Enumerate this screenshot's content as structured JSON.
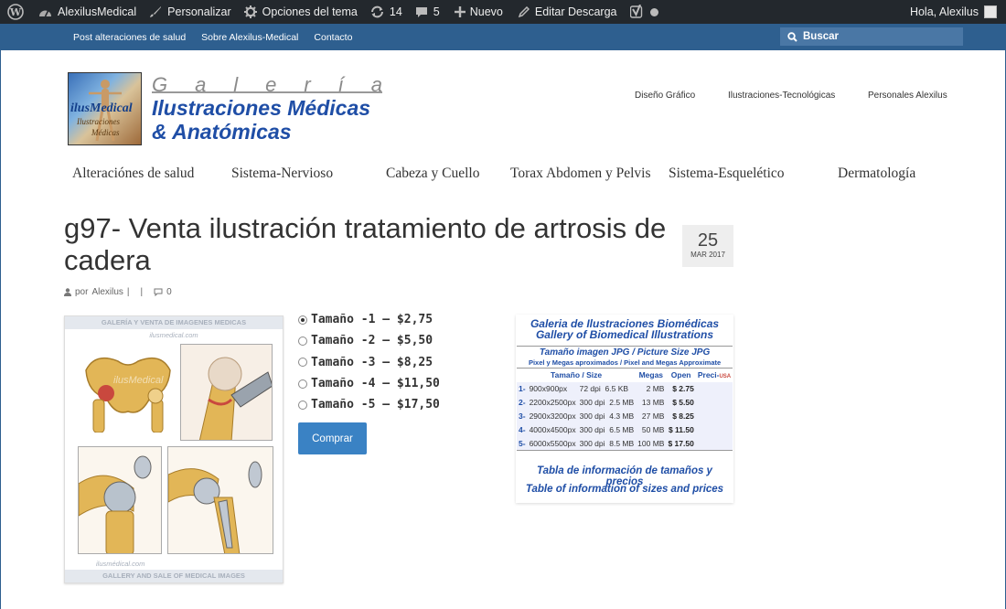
{
  "admin_bar": {
    "site_name": "AlexilusMedical",
    "customize": "Personalizar",
    "theme_options": "Opciones del tema",
    "updates_count": "14",
    "comments_count": "5",
    "new_label": "Nuevo",
    "edit_label": "Editar Descarga",
    "greeting": "Hola, Alexilus"
  },
  "secondary_nav": {
    "links": [
      "Post alteraciones de salud",
      "Sobre Alexilus-Medical",
      "Contacto"
    ],
    "search_placeholder": "Buscar"
  },
  "logo": {
    "image_line1": "ilusMedical",
    "image_line2": "Ilustraciones",
    "image_line3": "Médicas",
    "galeria_letters": [
      "G",
      "a",
      "l",
      "e",
      "r",
      "í",
      "a"
    ],
    "title_line1": "Ilustraciones Médicas",
    "title_line2": "& Anatómicas"
  },
  "top_menu": [
    "Diseño Gráfico",
    "Ilustraciones-Tecnológicas",
    "Personales Alexilus"
  ],
  "main_menu": [
    "Alteraciónes de salud",
    "Sistema-Nervioso",
    "Cabeza y Cuello",
    "Torax Abdomen y Pelvis",
    "Sistema-Esquelético",
    "Dermatología"
  ],
  "post": {
    "title": "g97- Venta ilustración tratamiento de artrosis de cadera",
    "date_day": "25",
    "date_month": "MAR 2017",
    "author_prefix": "por",
    "author": "Alexilus",
    "separator": "|",
    "comments": "0"
  },
  "product_image": {
    "header": "GALERÍA Y VENTA DE IMAGENES MEDICAS",
    "subheader": "ilusmedical.com",
    "footer_site": "ilusmédical.com",
    "footer": "GALLERY AND SALE OF MEDICAL IMAGES",
    "watermark": "ilusMedical"
  },
  "size_options": [
    {
      "label": "Tamaño -1 – $2,75",
      "selected": true
    },
    {
      "label": "Tamaño -2 – $5,50",
      "selected": false
    },
    {
      "label": "Tamaño -3 – $8,25",
      "selected": false
    },
    {
      "label": "Tamaño -4 – $11,50",
      "selected": false
    },
    {
      "label": "Tamaño -5 – $17,50",
      "selected": false
    }
  ],
  "buy_button": "Comprar",
  "price_table": {
    "heading1": "Galeria de Ilustraciones Biomédicas",
    "heading2": "Gallery of Biomedical Illustrations",
    "subtitle1": "Tamaño imagen JPG / Picture Size JPG",
    "subtitle2": "Pixel y Megas aproximados / Pixel and Megas Approximate",
    "columns": [
      "Tamaño / Size",
      "Megas",
      "Open",
      "Preci-",
      "USA"
    ],
    "rows": [
      [
        "1-",
        "900x900px",
        "72 dpi",
        "6.5 KB",
        "2 MB",
        "$ 2.75"
      ],
      [
        "2-",
        "2200x2500px",
        "300 dpi",
        "2.5 MB",
        "13 MB",
        "$ 5.50"
      ],
      [
        "3-",
        "2900x3200px",
        "300 dpi",
        "4.3 MB",
        "27 MB",
        "$ 8.25"
      ],
      [
        "4-",
        "4000x4500px",
        "300 dpi",
        "6.5 MB",
        "50 MB",
        "$ 11.50"
      ],
      [
        "5-",
        "6000x5500px",
        "300 dpi",
        "8.5 MB",
        "100 MB",
        "$ 17.50"
      ]
    ],
    "caption1": "Tabla de información de tamaños y precios",
    "caption2": "Table of information of sizes and prices"
  },
  "colors": {
    "admin_bar": "#23282d",
    "nav_blue": "#2e5f8f",
    "accent_blue": "#3a82c4",
    "logo_blue": "#1f4ea6"
  }
}
